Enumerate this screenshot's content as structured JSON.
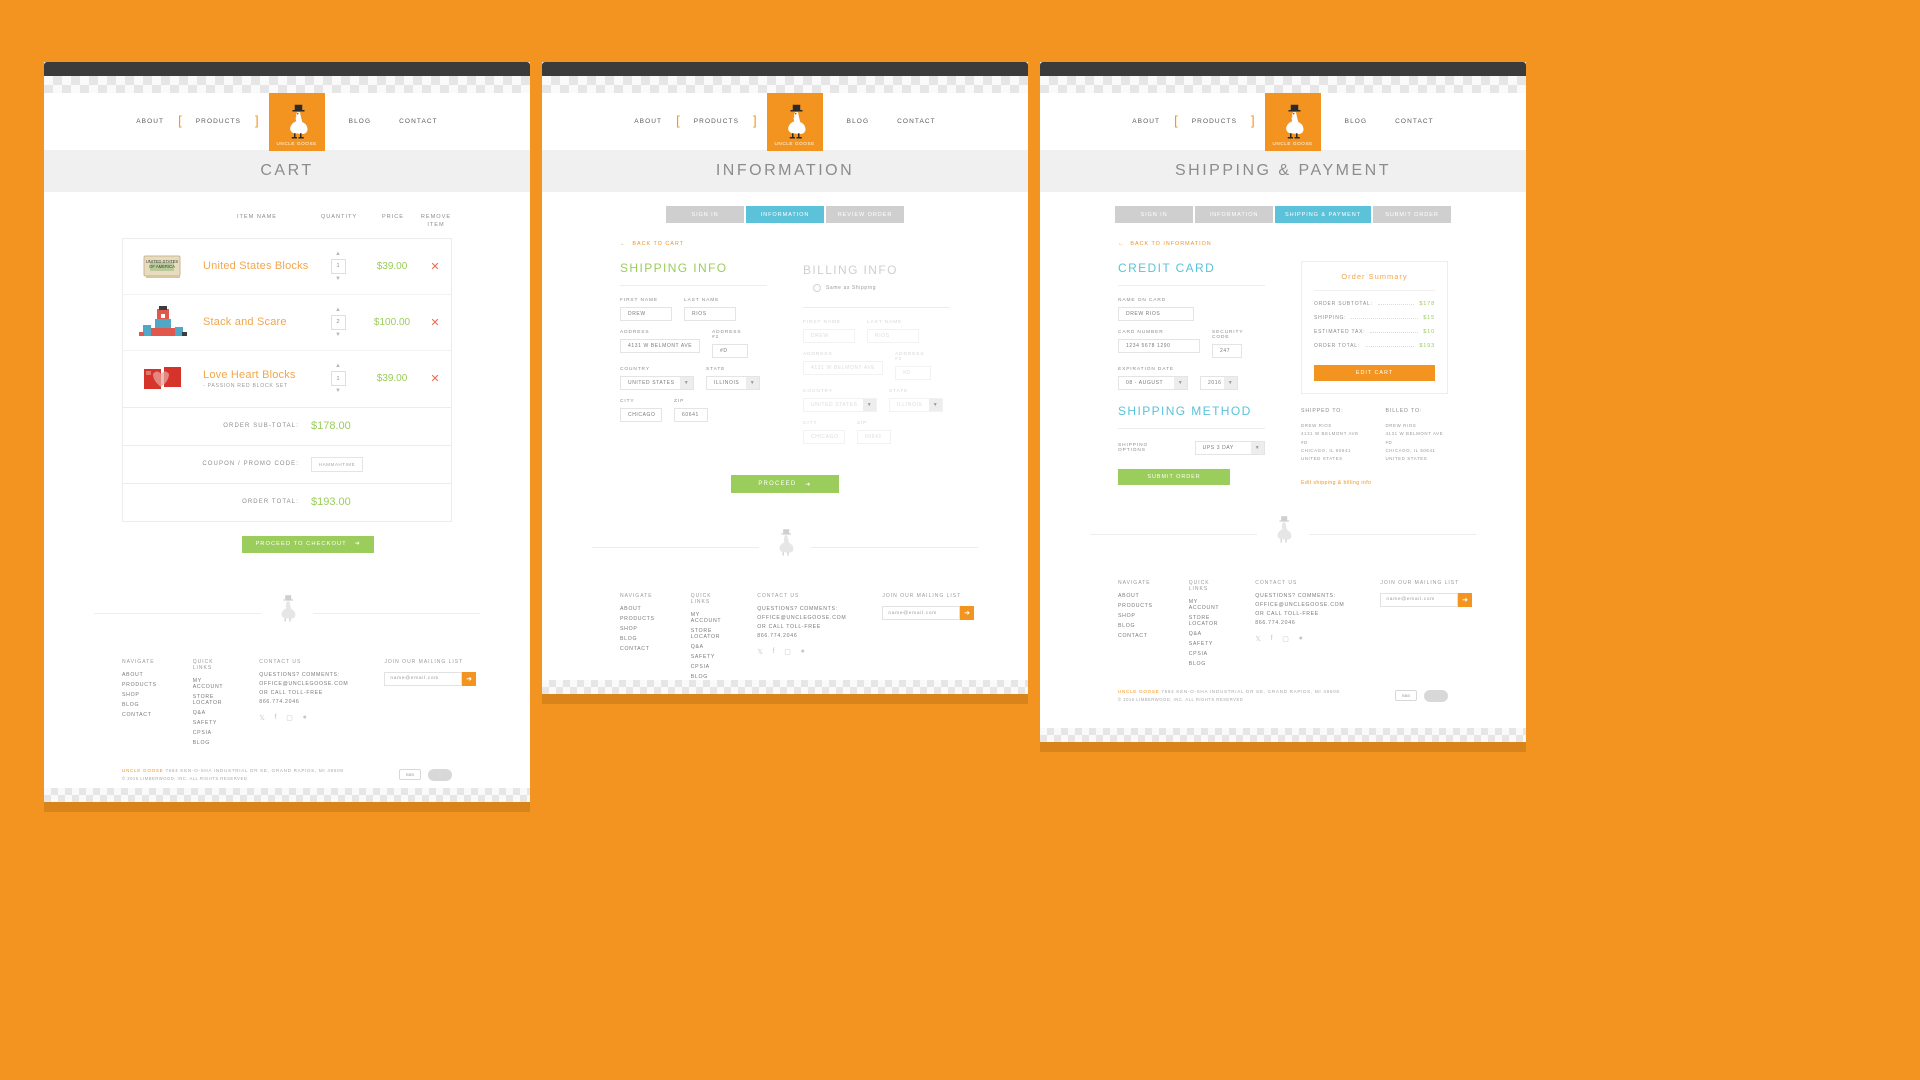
{
  "brand": {
    "name": "UNCLE GOOSE",
    "accent": "#F2941F",
    "green": "#9ACD5B",
    "blue": "#5BC2DA",
    "red": "#F26A4B"
  },
  "nav": {
    "items": [
      {
        "label": "ABOUT"
      },
      {
        "label": "PRODUCTS"
      },
      {
        "label": "BLOG"
      },
      {
        "label": "CONTACT"
      }
    ],
    "logo_label": "UNCLE GOOSE"
  },
  "panel_cart": {
    "title": "CART",
    "table_headers": {
      "item": "ITEM NAME",
      "quantity": "QUANTITY",
      "price": "PRICE",
      "remove_l1": "REMOVE",
      "remove_l2": "ITEM"
    },
    "items": [
      {
        "name": "United States Blocks",
        "sub": "",
        "qty": "1",
        "price": "$39.00",
        "remove": "✕"
      },
      {
        "name": "Stack and Scare",
        "sub": "",
        "qty": "2",
        "price": "$100.00",
        "remove": "✕"
      },
      {
        "name": "Love Heart Blocks",
        "sub": "- PASSION RED BLOCK SET",
        "qty": "1",
        "price": "$39.00",
        "remove": "✕"
      }
    ],
    "subtotal_label": "ORDER SUB-TOTAL:",
    "subtotal_value": "$178.00",
    "coupon_label": "COUPON / PROMO CODE:",
    "coupon_value": "HAMMAHTIME",
    "total_label": "ORDER TOTAL:",
    "total_value": "$193.00",
    "checkout_label": "PROCEED TO CHECKOUT",
    "checkout_arrow": "➜"
  },
  "panel_information": {
    "title": "INFORMATION",
    "steps": [
      {
        "label": "SIGN IN",
        "active": false
      },
      {
        "label": "INFORMATION",
        "active": true
      },
      {
        "label": "REVIEW ORDER",
        "active": false
      }
    ],
    "back_link": "BACK TO CART",
    "back_arrow": "←",
    "shipping_heading": "SHIPPING INFO",
    "billing_heading": "BILLING INFO",
    "same_as_shipping": "Same as Shipping",
    "labels": {
      "first_name": "FIRST NAME",
      "last_name": "LAST NAME",
      "address": "ADDRESS",
      "address2": "ADDRESS #2",
      "country": "COUNTRY",
      "state": "STATE",
      "city": "CITY",
      "zip": "ZIP"
    },
    "shipping_values": {
      "first_name": "DREW",
      "last_name": "RIOS",
      "address": "4131 W BELMONT AVE",
      "address2": "#D",
      "country": "UNITED STATES",
      "state": "ILLINOIS",
      "city": "CHICAGO",
      "zip": "60641"
    },
    "billing_values": {
      "first_name": "DREW",
      "last_name": "RIOS",
      "address": "4131 W BELMONT AVE",
      "address2": "#D",
      "country": "UNITED STATES",
      "state": "ILLINOIS",
      "city": "CHICAGO",
      "zip": "60641"
    },
    "proceed_label": "PROCEED",
    "proceed_arrow": "➜"
  },
  "panel_payment": {
    "title": "SHIPPING & PAYMENT",
    "steps": [
      {
        "label": "SIGN IN",
        "active": false
      },
      {
        "label": "INFORMATION",
        "active": false
      },
      {
        "label": "SHIPPING & PAYMENT",
        "active": true
      },
      {
        "label": "SUBMIT ORDER",
        "active": false
      }
    ],
    "back_link": "BACK TO INFORMATION",
    "back_arrow": "←",
    "credit_card_heading": "CREDIT CARD",
    "shipping_method_heading": "SHIPPING METHOD",
    "labels": {
      "name_on_card": "NAME ON CARD",
      "card_number": "CARD NUMBER",
      "security_code": "SECURITY CODE",
      "expiration_date": "EXPIRATION DATE",
      "shipping_options": "SHIPPING OPTIONS"
    },
    "values": {
      "name_on_card": "DREW RIOS",
      "card_number": "1234 5678 1290",
      "security_code": "247",
      "exp_month": "08 - AUGUST",
      "exp_year": "2016",
      "shipping_option": "UPS 3 DAY"
    },
    "submit_label": "SUBMIT ORDER",
    "summary": {
      "heading": "Order Summary",
      "rows": [
        {
          "key": "ORDER SUBTOTAL:",
          "value": "$178"
        },
        {
          "key": "SHIPPING:",
          "value": "$15"
        },
        {
          "key": "ESTIMATED TAX:",
          "value": "$10"
        },
        {
          "key": "ORDER TOTAL:",
          "value": "$193"
        }
      ],
      "edit_cart_label": "EDIT CART",
      "shipped_to_heading": "SHIPPED TO:",
      "billed_to_heading": "BILLED TO:",
      "shipped_to_lines": "DREW RIOS\n4131 W BELMONT AVE #D\nCHICAGO, IL 60641\nUNITED STATES",
      "billed_to_lines": "DREW RIOS\n4131 W BELMONT AVE #D\nCHICAGO, IL 60641\nUNITED STATES",
      "edit_link": "Edit shipping & billing info"
    }
  },
  "footer": {
    "columns": [
      {
        "heading": "NAVIGATE",
        "links": [
          "ABOUT",
          "PRODUCTS",
          "SHOP",
          "BLOG",
          "CONTACT"
        ]
      },
      {
        "heading": "QUICK LINKS",
        "links": [
          "MY ACCOUNT",
          "STORE LOCATOR",
          "Q&A",
          "SAFETY",
          "CPSIA",
          "BLOG"
        ]
      }
    ],
    "contact_heading": "CONTACT US",
    "contact_lines": [
      "QUESTIONS? COMMENTS:",
      "OFFICE@UNCLEGOOSE.COM",
      "OR CALL TOLL-FREE",
      "866.774.2046"
    ],
    "mailing_heading": "JOIN OUR MAILING LIST",
    "mailing_placeholder": "name@email.com",
    "mailing_arrow": "➜",
    "social": [
      "twitter-icon",
      "facebook-icon",
      "instagram-icon",
      "pinterest-icon"
    ],
    "legal_brand": "UNCLE GOOSE",
    "legal_address": "7684 KEN-O-SHA INDUSTRIAL DR SE, GRAND RAPIDS, MI 49508",
    "legal_copyright": "© 2016 LIMBERWOOD, INC. ALL RIGHTS RESERVED",
    "badge_a": "BBB",
    "badge_b": "seal-badge"
  }
}
